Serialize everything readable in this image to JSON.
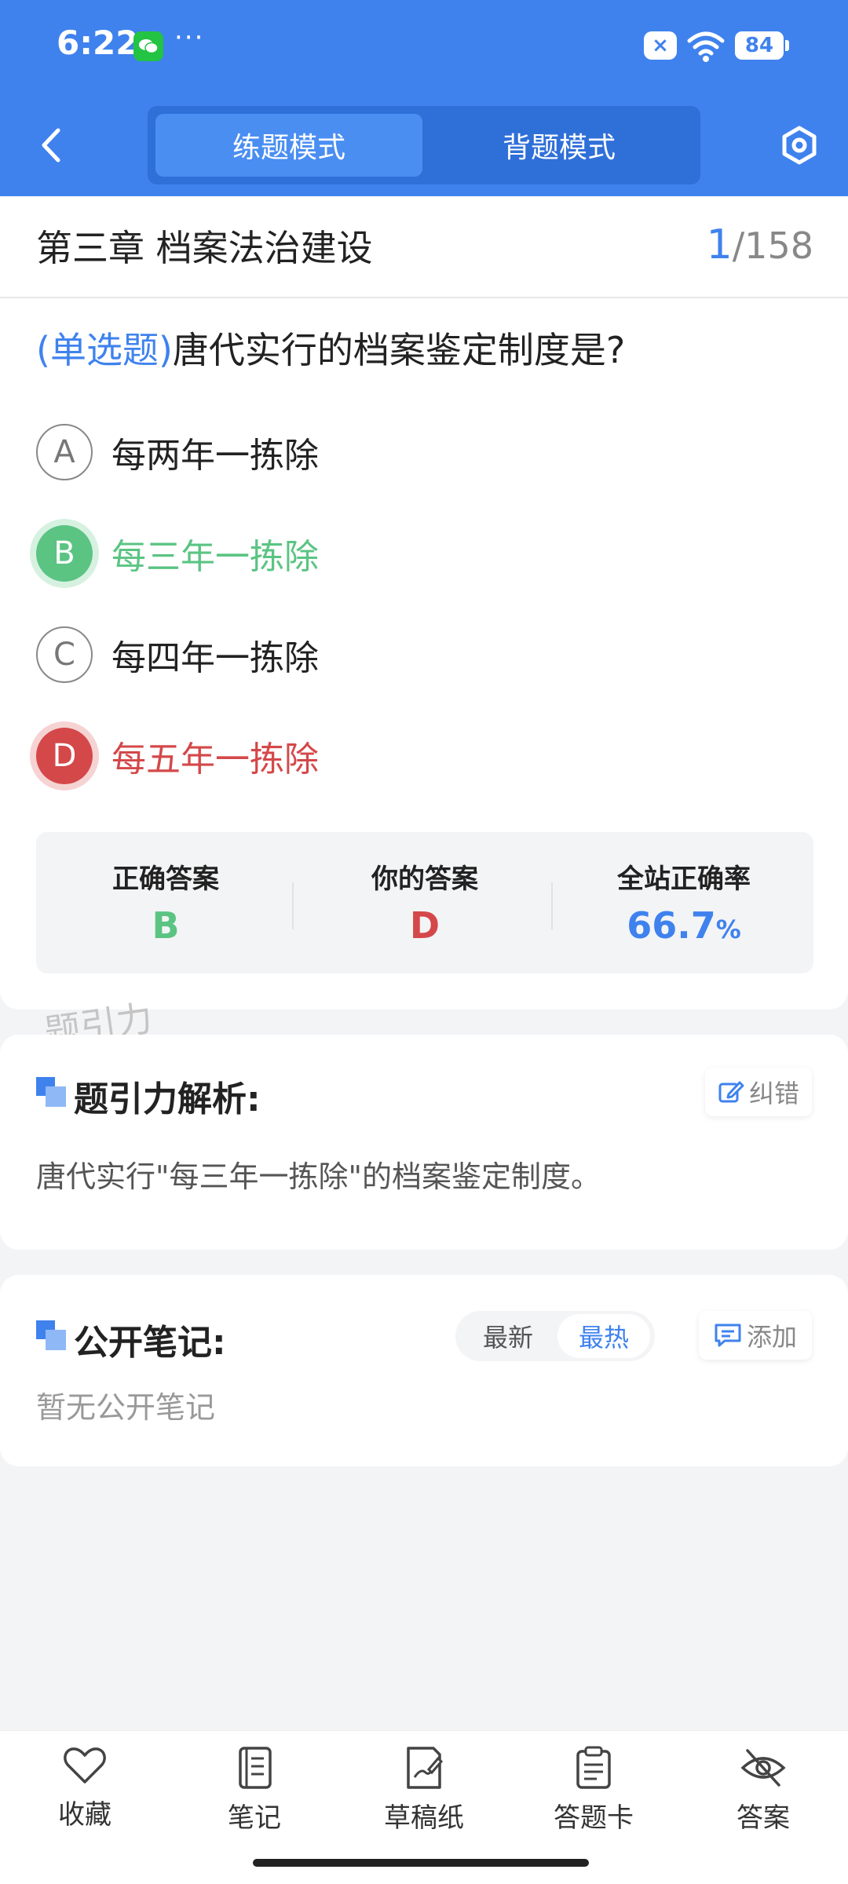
{
  "status_bar": {
    "time": "6:22",
    "dots": "···",
    "battery": "84"
  },
  "header": {
    "modes": {
      "practice": "练题模式",
      "memorize": "背题模式"
    },
    "active_mode": "practice"
  },
  "question_header": {
    "chapter": "第三章 档案法治建设",
    "current": "1",
    "total": "/158"
  },
  "question": {
    "type": "(单选题)",
    "text": "唐代实行的档案鉴定制度是?",
    "options": [
      {
        "letter": "A",
        "text": "每两年一拣除",
        "state": "normal"
      },
      {
        "letter": "B",
        "text": "每三年一拣除",
        "state": "correct"
      },
      {
        "letter": "C",
        "text": "每四年一拣除",
        "state": "normal"
      },
      {
        "letter": "D",
        "text": "每五年一拣除",
        "state": "wrong"
      }
    ]
  },
  "stats": {
    "correct_label": "正确答案",
    "correct_value": "B",
    "yours_label": "你的答案",
    "yours_value": "D",
    "rate_label": "全站正确率",
    "rate_value": "66.7",
    "rate_unit": "%"
  },
  "watermark": "题引力",
  "analysis": {
    "title": "题引力解析:",
    "report_button": "纠错",
    "text": "唐代实行\"每三年一拣除\"的档案鉴定制度。"
  },
  "notes": {
    "title": "公开笔记:",
    "sort_options": [
      "最新",
      "最热"
    ],
    "active_sort": "最热",
    "add_button": "添加",
    "empty_text": "暂无公开笔记"
  },
  "bottom_tabs": [
    {
      "label": "收藏",
      "icon": "heart-icon"
    },
    {
      "label": "笔记",
      "icon": "notebook-icon"
    },
    {
      "label": "草稿纸",
      "icon": "draft-paper-icon"
    },
    {
      "label": "答题卡",
      "icon": "answer-card-icon"
    },
    {
      "label": "答案",
      "icon": "eye-off-icon"
    }
  ],
  "colors": {
    "primary": "#3f82ee",
    "correct": "#5bc483",
    "wrong": "#d4484a"
  }
}
